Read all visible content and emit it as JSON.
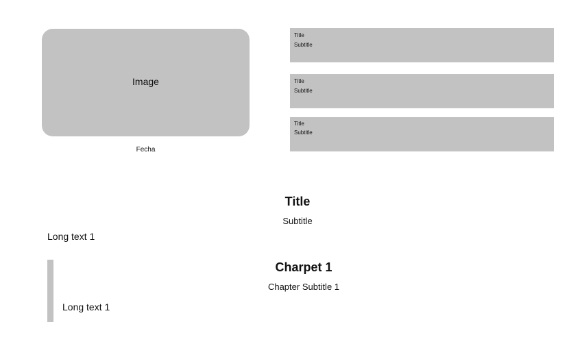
{
  "hero": {
    "image_label": "Image",
    "caption": "Fecha"
  },
  "cards": [
    {
      "title": "Title",
      "subtitle": "Subtitle"
    },
    {
      "title": "Title",
      "subtitle": "Subtitle"
    },
    {
      "title": "Title",
      "subtitle": "Subtitle"
    }
  ],
  "section": {
    "title": "Title",
    "subtitle": "Subtitle",
    "body": "Long text 1"
  },
  "chapter": {
    "title": "Charpet 1",
    "subtitle": "Chapter Subtitle 1",
    "body": "Long text 1"
  },
  "colors": {
    "placeholder": "#c2c2c2",
    "background": "#ffffff",
    "text": "#111111"
  }
}
